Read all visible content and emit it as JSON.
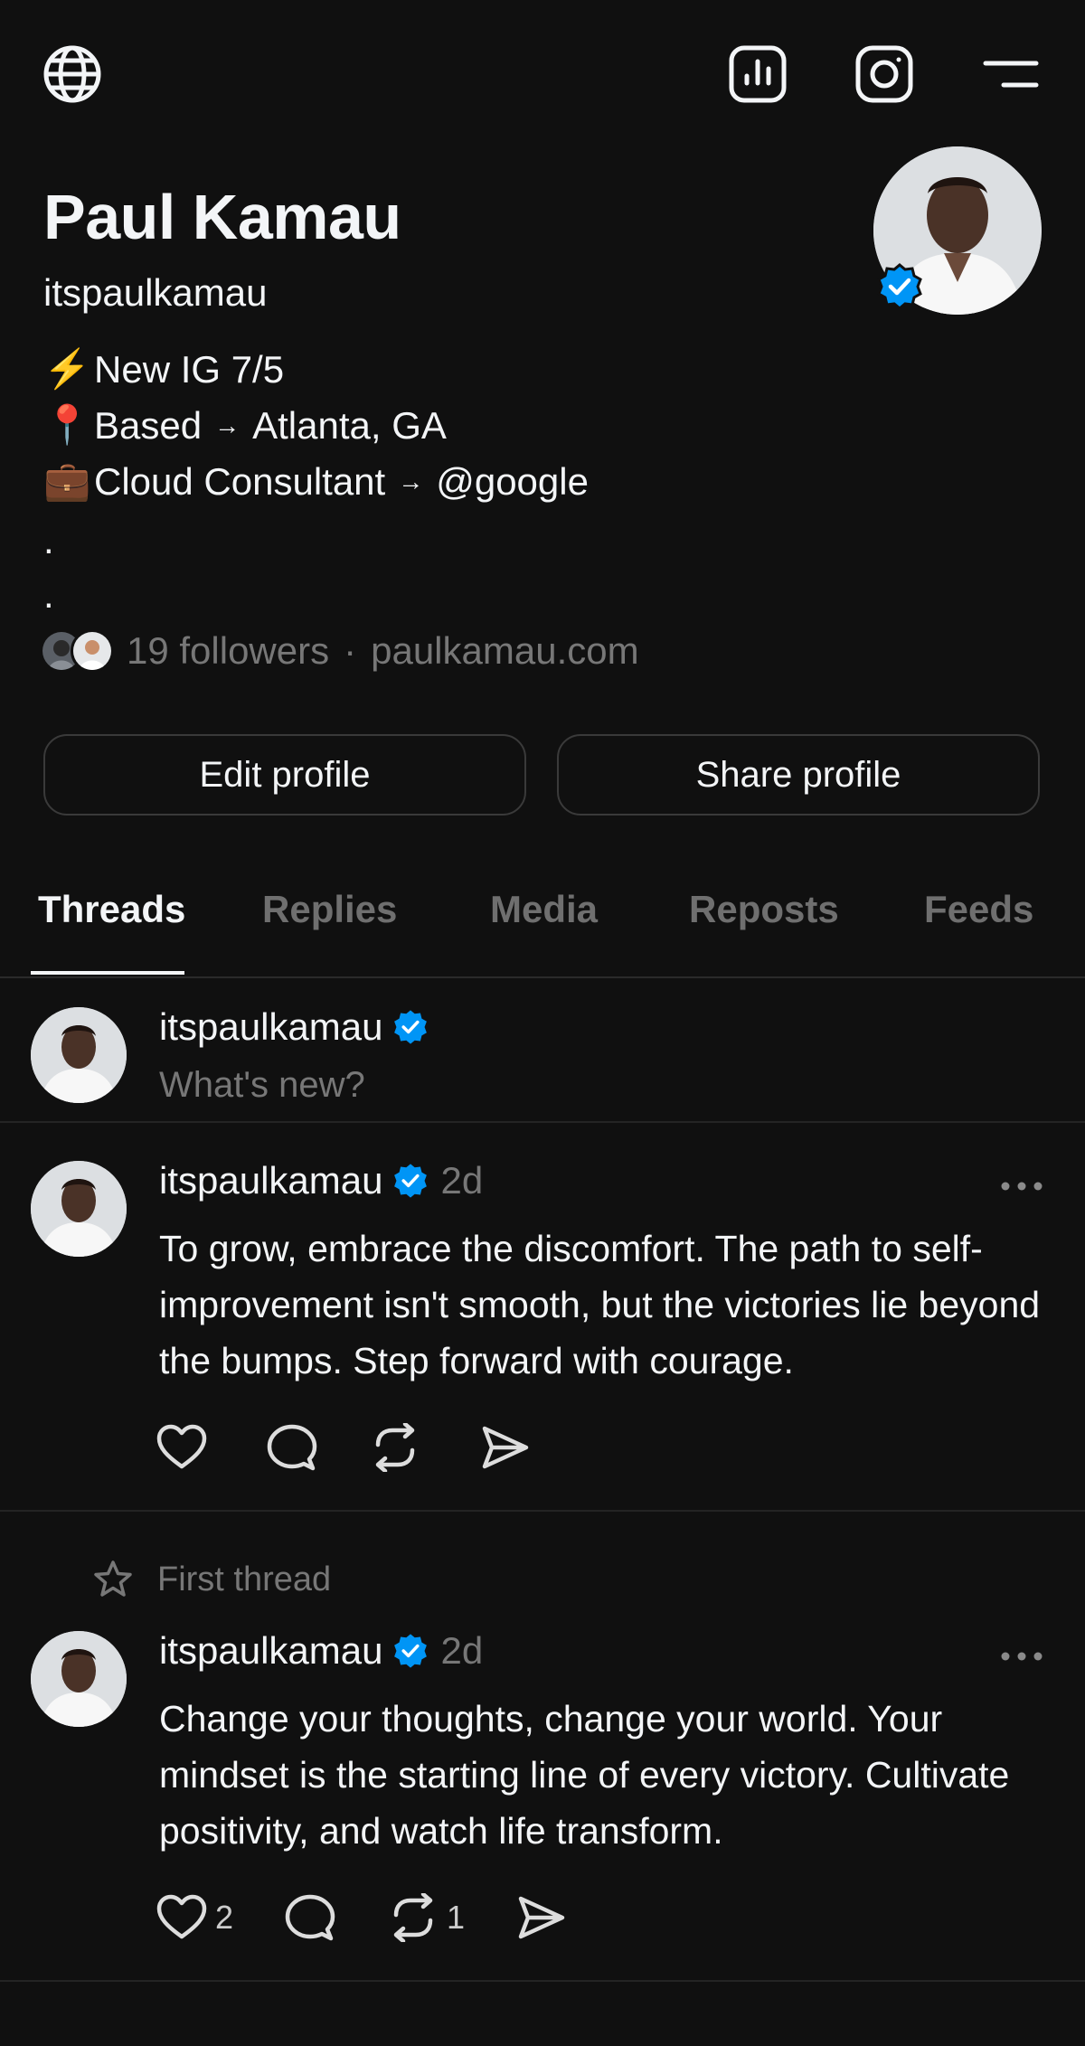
{
  "profile": {
    "name": "Paul Kamau",
    "handle": "itspaulkamau",
    "bio": {
      "line1_icon": "⚡",
      "line1_text": "New IG 7/5",
      "line2_icon": "📍",
      "line2_label": "Based",
      "line2_arrow": "→",
      "line2_value": "Atlanta, GA",
      "line3_icon": "💼",
      "line3_label": "Cloud Consultant",
      "line3_arrow": "→",
      "line3_value": "@google",
      "dot1": ".",
      "dot2": "."
    },
    "followers": "19 followers",
    "separator": "·",
    "website": "paulkamau.com"
  },
  "buttons": {
    "edit": "Edit profile",
    "share": "Share profile"
  },
  "tabs": [
    "Threads",
    "Replies",
    "Media",
    "Reposts",
    "Feeds"
  ],
  "composer": {
    "username": "itspaulkamau",
    "placeholder": "What's new?"
  },
  "posts": [
    {
      "username": "itspaulkamau",
      "time": "2d",
      "text": "To grow, embrace the discomfort. The path to self-improvement isn't smooth, but the victories lie beyond the bumps. Step forward with courage.",
      "likes": "",
      "reposts": ""
    },
    {
      "pinned_label": "First thread",
      "username": "itspaulkamau",
      "time": "2d",
      "text": "Change your thoughts, change your world. Your mindset is the starting line of every victory. Cultivate positivity, and watch life transform.",
      "likes": "2",
      "reposts": "1"
    }
  ],
  "colors": {
    "background": "#101010",
    "text": "#f3f5f7",
    "muted": "#777777",
    "verified": "#0095f6"
  },
  "icons": [
    "globe-icon",
    "insights-icon",
    "instagram-icon",
    "menu-icon",
    "verified-icon",
    "heart-icon",
    "comment-icon",
    "repost-icon",
    "share-icon",
    "more-icon",
    "star-icon"
  ]
}
